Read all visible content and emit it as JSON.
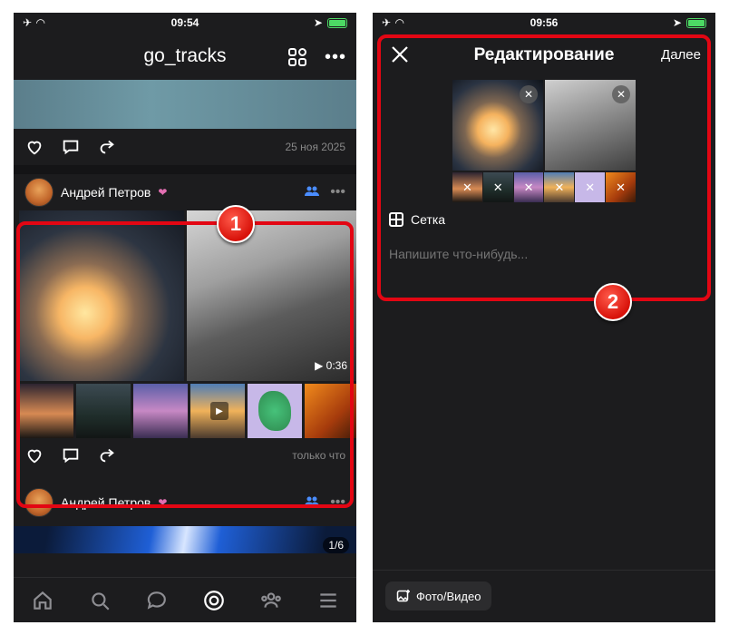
{
  "left": {
    "status": {
      "time": "09:54"
    },
    "header": {
      "title": "go_tracks",
      "more": "•••"
    },
    "prev_post": {
      "date": "25 ноя 2025"
    },
    "post": {
      "author": "Андрей Петров",
      "badge": "❤",
      "more": "•••",
      "video_duration": "▶ 0:36",
      "time": "только что"
    },
    "post2": {
      "author": "Андрей Петров",
      "badge": "❤",
      "more": "•••",
      "counter": "1/6"
    },
    "annotation": "1"
  },
  "right": {
    "status": {
      "time": "09:56"
    },
    "header": {
      "title": "Редактирование",
      "next": "Далее"
    },
    "grid_label": "Сетка",
    "compose_placeholder": "Напишите что-нибудь...",
    "media_button": "Фото/Видео",
    "remove": "✕",
    "annotation": "2"
  },
  "colors": {
    "accent_red": "#e30613",
    "bg_dark": "#1c1c1e",
    "link_blue": "#4a8dff"
  }
}
